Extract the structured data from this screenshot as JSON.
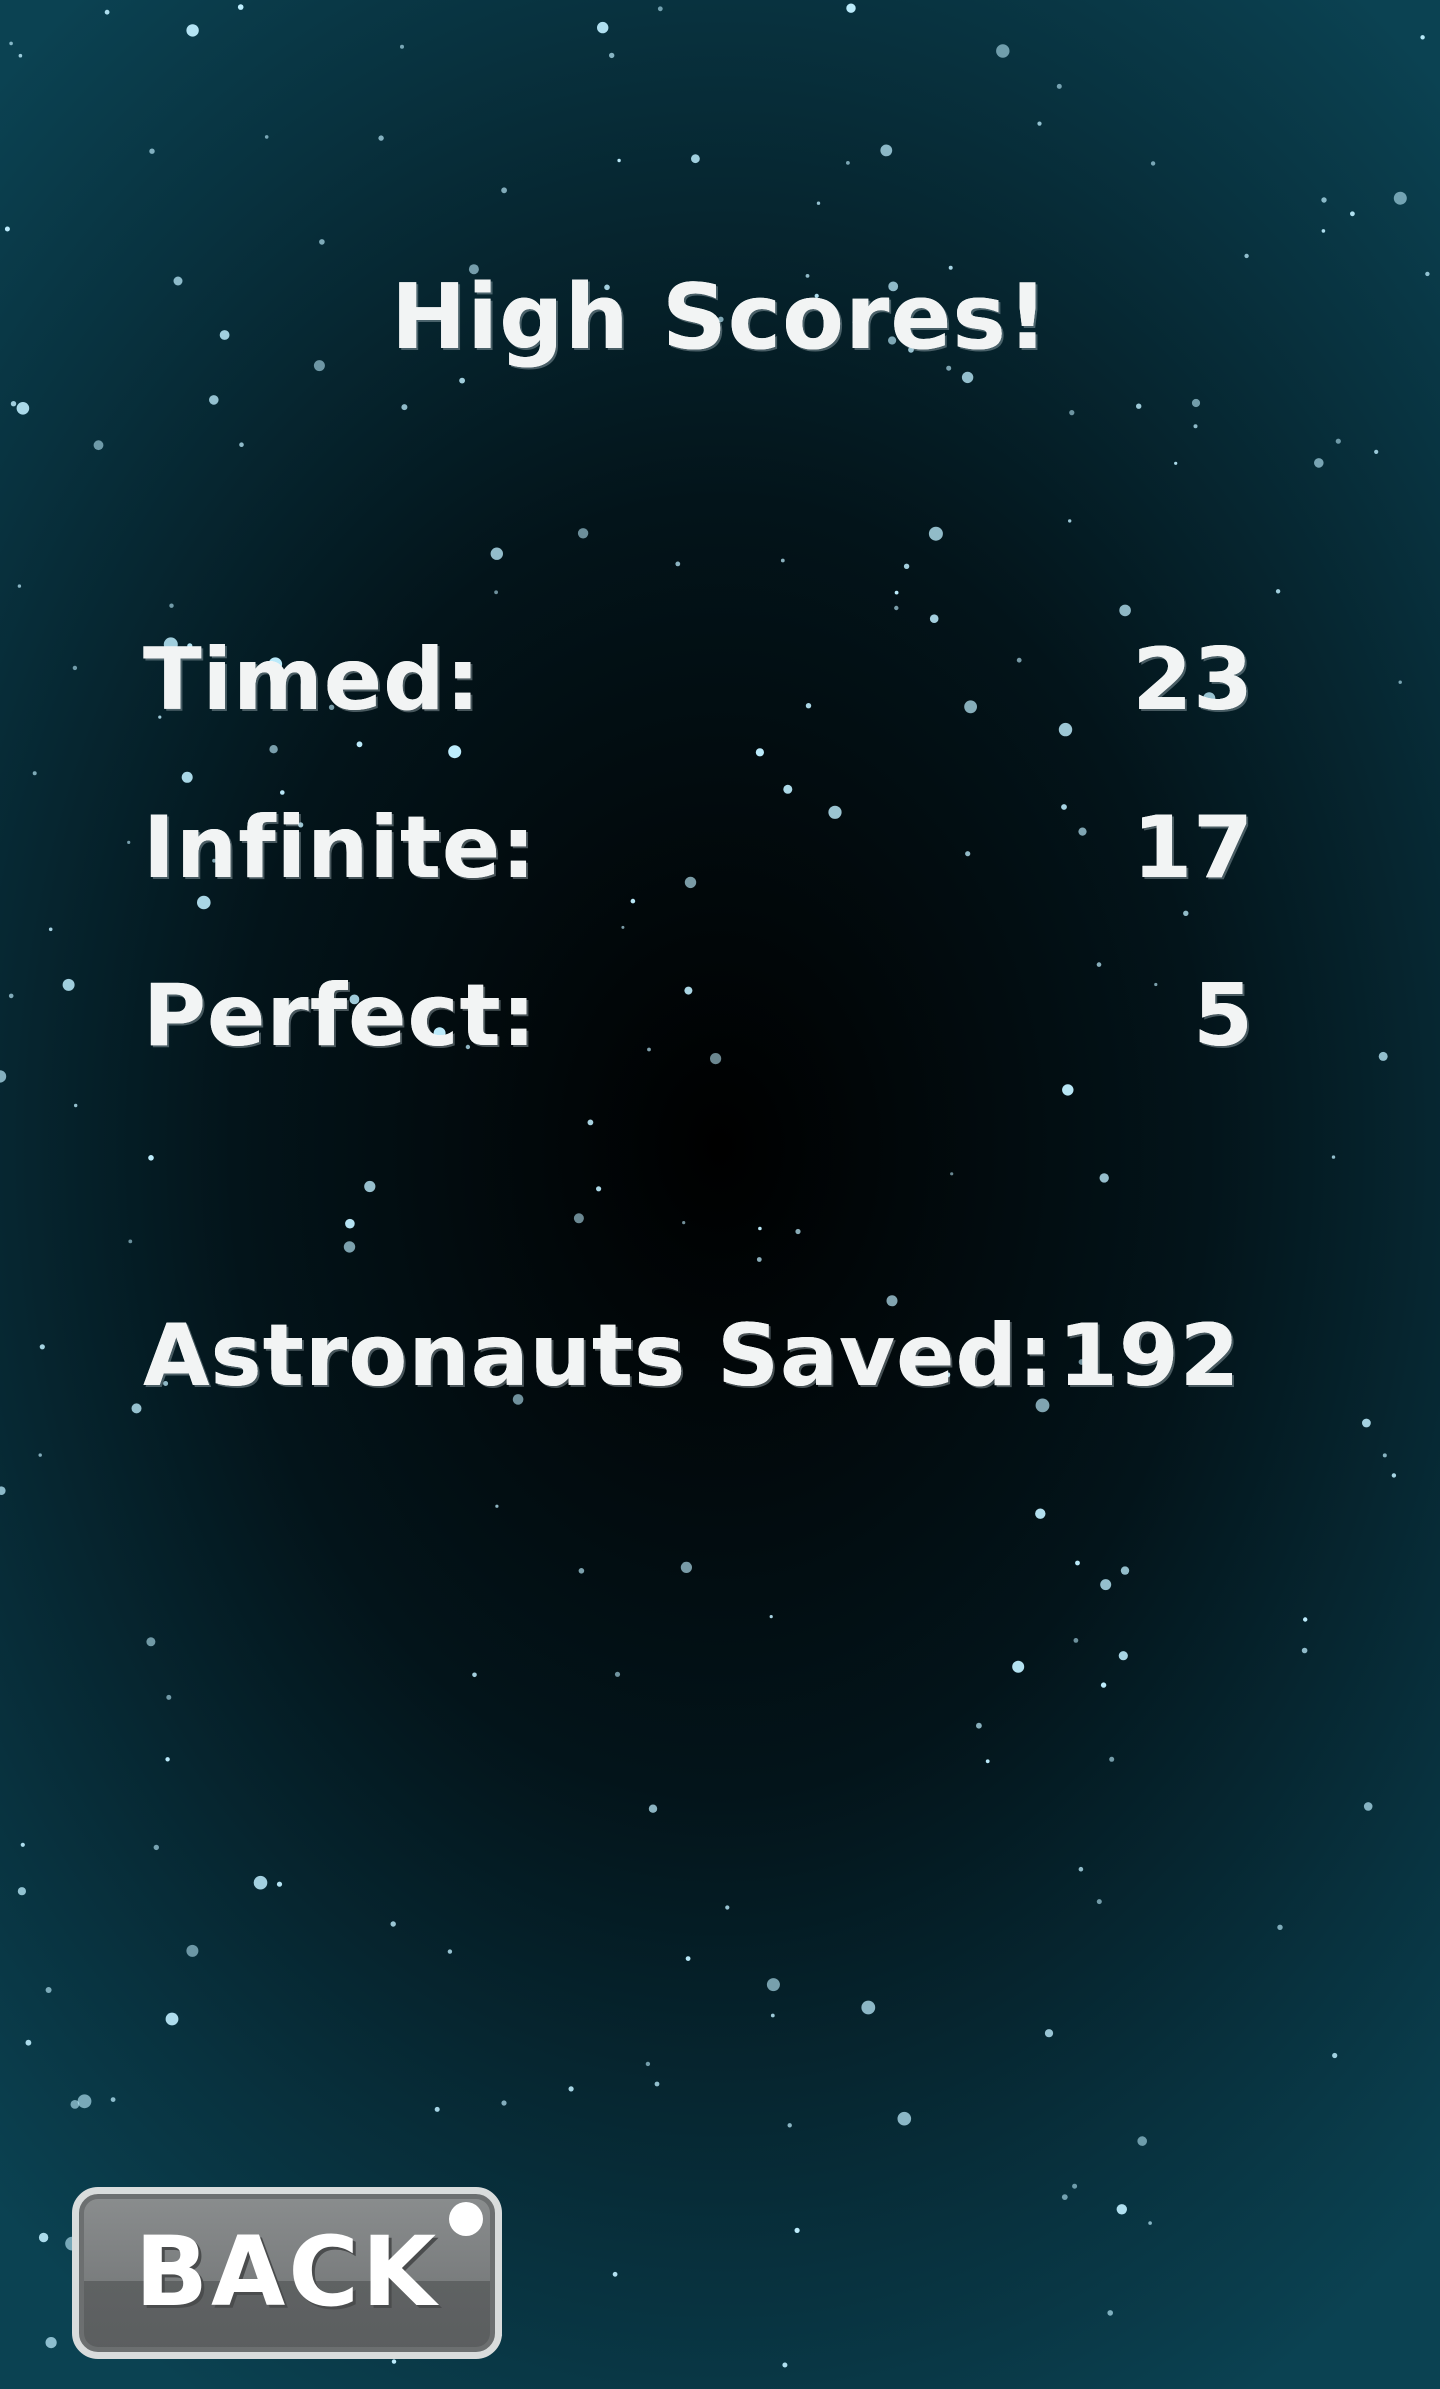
{
  "screen": {
    "title": "High Scores!"
  },
  "scores": [
    {
      "label": "Timed:",
      "value": "23"
    },
    {
      "label": "Infinite:",
      "value": "17"
    },
    {
      "label": "Perfect:",
      "value": "5"
    }
  ],
  "astronauts": {
    "label": "Astronauts Saved:",
    "value": "192"
  },
  "back_button": {
    "label": "BACK"
  },
  "colors": {
    "background_center": "#000000",
    "background_edge": "#0b4252",
    "text": "#f2f4f4",
    "star": "#bfefff",
    "button_face": "#7a7d7e",
    "button_border": "#d9dcdc"
  }
}
